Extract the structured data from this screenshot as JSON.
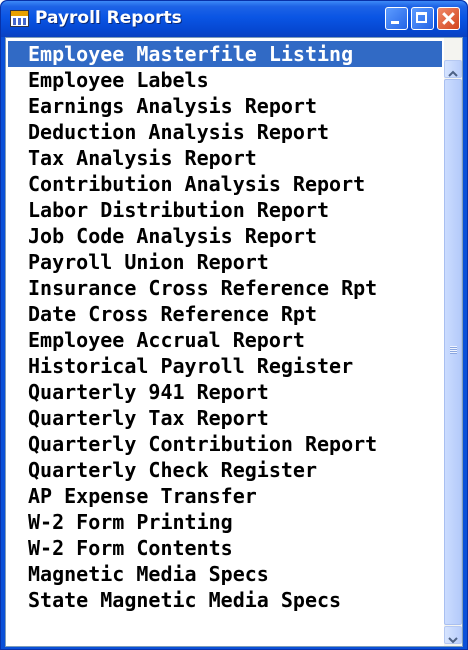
{
  "window": {
    "title": "Payroll Reports",
    "icon": "report-window-icon",
    "colors": {
      "titlebar": "#0a55e4",
      "selection": "#316ac5",
      "close_button": "#d2431c"
    }
  },
  "list": {
    "selected_index": 0,
    "items": [
      "Employee Masterfile Listing",
      "Employee Labels",
      "Earnings Analysis Report",
      "Deduction Analysis Report",
      "Tax Analysis Report",
      "Contribution Analysis Report",
      "Labor Distribution Report",
      "Job Code Analysis Report",
      "Payroll Union Report",
      "Insurance Cross Reference Rpt",
      "Date Cross Reference Rpt",
      "Employee Accrual Report",
      "Historical Payroll Register",
      "Quarterly 941 Report",
      "Quarterly Tax Report",
      "Quarterly Contribution Report",
      "Quarterly Check Register",
      "AP Expense Transfer",
      "W-2 Form Printing",
      "W-2 Form Contents",
      "Magnetic Media Specs",
      "State Magnetic Media Specs"
    ]
  },
  "scrollbar": {
    "position_fraction": 0.0
  }
}
